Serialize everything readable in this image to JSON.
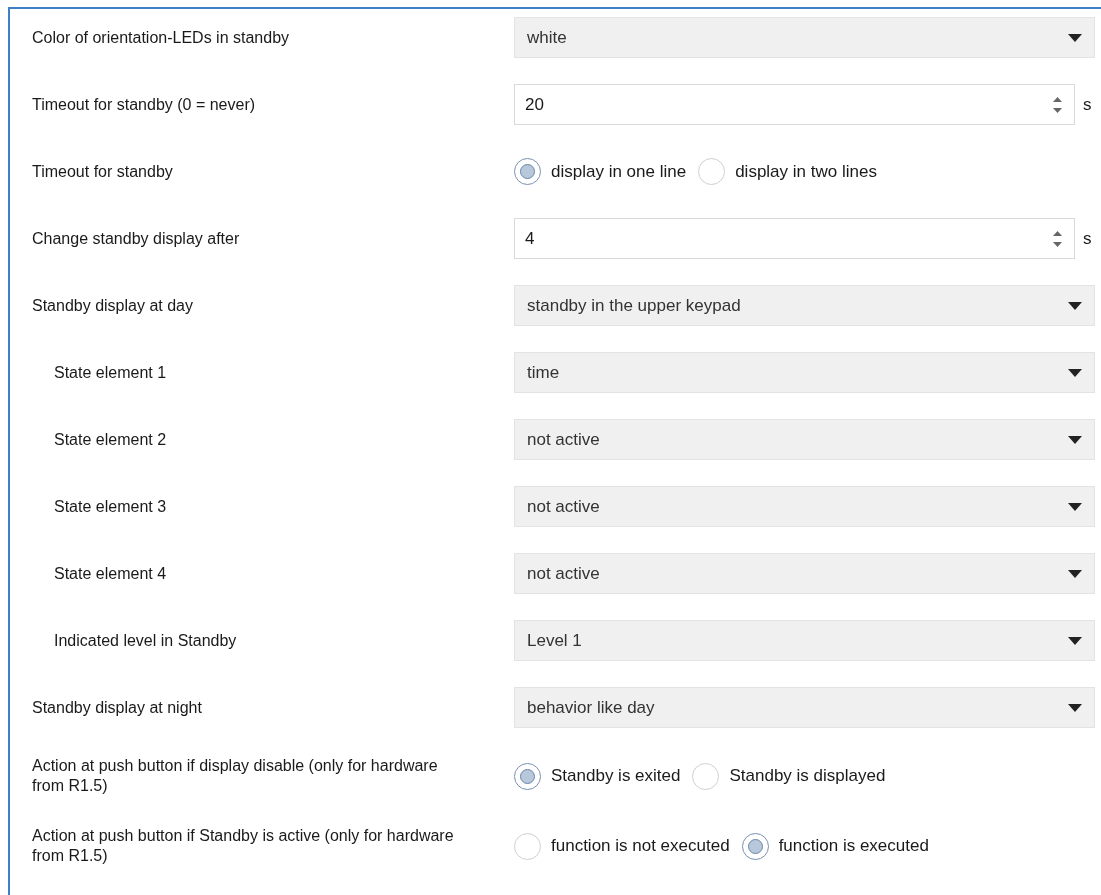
{
  "settings": [
    {
      "label": "Color of orientation-LEDs in standby",
      "kind": "select",
      "value": "white"
    },
    {
      "label": "Timeout for standby (0 = never)",
      "kind": "spin",
      "value": "20",
      "unit": "s"
    },
    {
      "label": "Timeout for standby",
      "kind": "radio",
      "options": [
        {
          "label": "display in one line",
          "selected": true
        },
        {
          "label": "display in two lines",
          "selected": false
        }
      ]
    },
    {
      "label": "Change standby display after",
      "kind": "spin",
      "value": "4",
      "unit": "s"
    },
    {
      "label": "Standby display at day",
      "kind": "select",
      "value": "standby in the upper keypad",
      "children": [
        {
          "label": "State element 1",
          "kind": "select",
          "value": "time"
        },
        {
          "label": "State element 2",
          "kind": "select",
          "value": "not active"
        },
        {
          "label": "State element 3",
          "kind": "select",
          "value": "not active"
        },
        {
          "label": "State element 4",
          "kind": "select",
          "value": "not active"
        },
        {
          "label": "Indicated level in Standby",
          "kind": "select",
          "value": "Level 1"
        }
      ]
    },
    {
      "label": "Standby display at night",
      "kind": "select",
      "value": "behavior like day"
    },
    {
      "label": "Action at push button if display disable (only for hardware from R1.5)",
      "kind": "radio",
      "options": [
        {
          "label": "Standby is exited",
          "selected": true
        },
        {
          "label": "Standby is displayed",
          "selected": false
        }
      ]
    },
    {
      "label": "Action at push button if Standby is active (only for hardware from R1.5)",
      "kind": "radio",
      "options": [
        {
          "label": "function is not executed",
          "selected": false
        },
        {
          "label": "function is executed",
          "selected": true
        }
      ]
    }
  ]
}
